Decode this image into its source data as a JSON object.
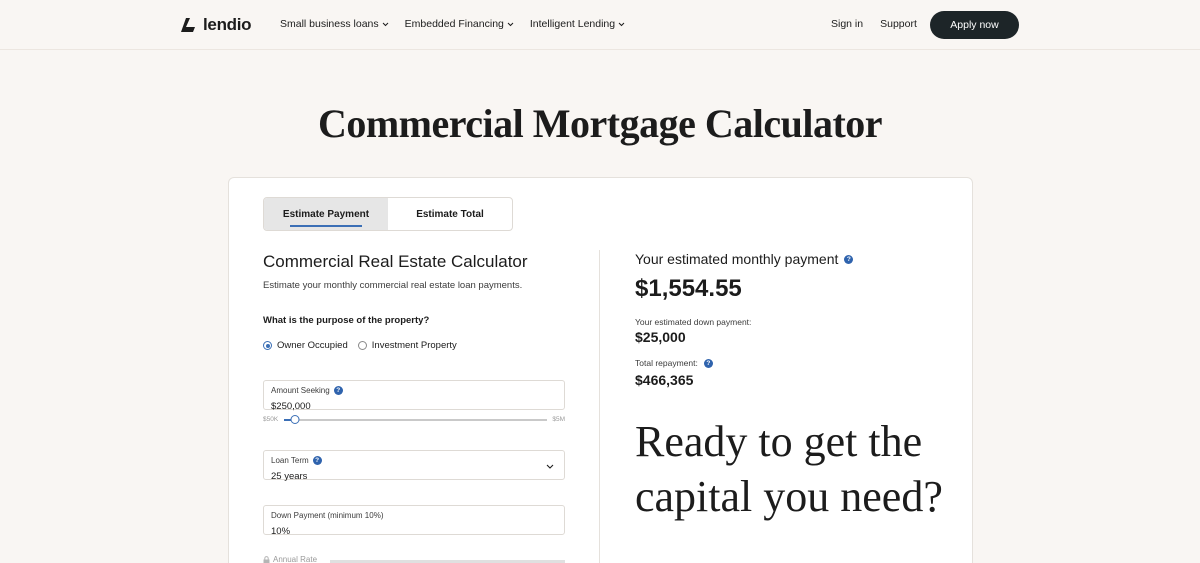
{
  "nav": {
    "logo_text": "lendio",
    "menu": [
      {
        "label": "Small business loans"
      },
      {
        "label": "Embedded Financing"
      },
      {
        "label": "Intelligent Lending"
      }
    ],
    "sign_in": "Sign in",
    "support": "Support",
    "apply": "Apply now"
  },
  "page": {
    "title": "Commercial Mortgage Calculator"
  },
  "tabs": [
    {
      "label": "Estimate Payment",
      "active": true
    },
    {
      "label": "Estimate Total",
      "active": false
    }
  ],
  "calculator": {
    "title": "Commercial Real Estate Calculator",
    "subtitle": "Estimate your monthly commercial real estate loan payments.",
    "purpose_question": "What is the purpose of the property?",
    "purpose_options": [
      {
        "label": "Owner Occupied",
        "checked": true
      },
      {
        "label": "Investment Property",
        "checked": false
      }
    ],
    "amount": {
      "label": "Amount Seeking",
      "value": "$250,000",
      "slider_min": "$50K",
      "slider_max": "$5M",
      "slider_fraction": 0.04
    },
    "loan_term": {
      "label": "Loan Term",
      "value": "25 years"
    },
    "down_payment": {
      "label": "Down Payment (minimum 10%)",
      "value": "10%"
    },
    "annual_rate": {
      "label": "Annual Rate"
    }
  },
  "results": {
    "monthly_label": "Your estimated monthly payment",
    "monthly_value": "$1,554.55",
    "down_label": "Your estimated down payment:",
    "down_value": "$25,000",
    "total_label": "Total repayment:",
    "total_value": "$466,365"
  },
  "cta": {
    "text": "Ready to get the capital you need?"
  },
  "colors": {
    "accent": "#3b6fb6",
    "help": "#2f63ad",
    "button": "#1d2528",
    "background": "#f9f6f3"
  },
  "icons": [
    "lendio-logo-icon",
    "chevron-down-icon",
    "help-icon",
    "lock-icon"
  ]
}
